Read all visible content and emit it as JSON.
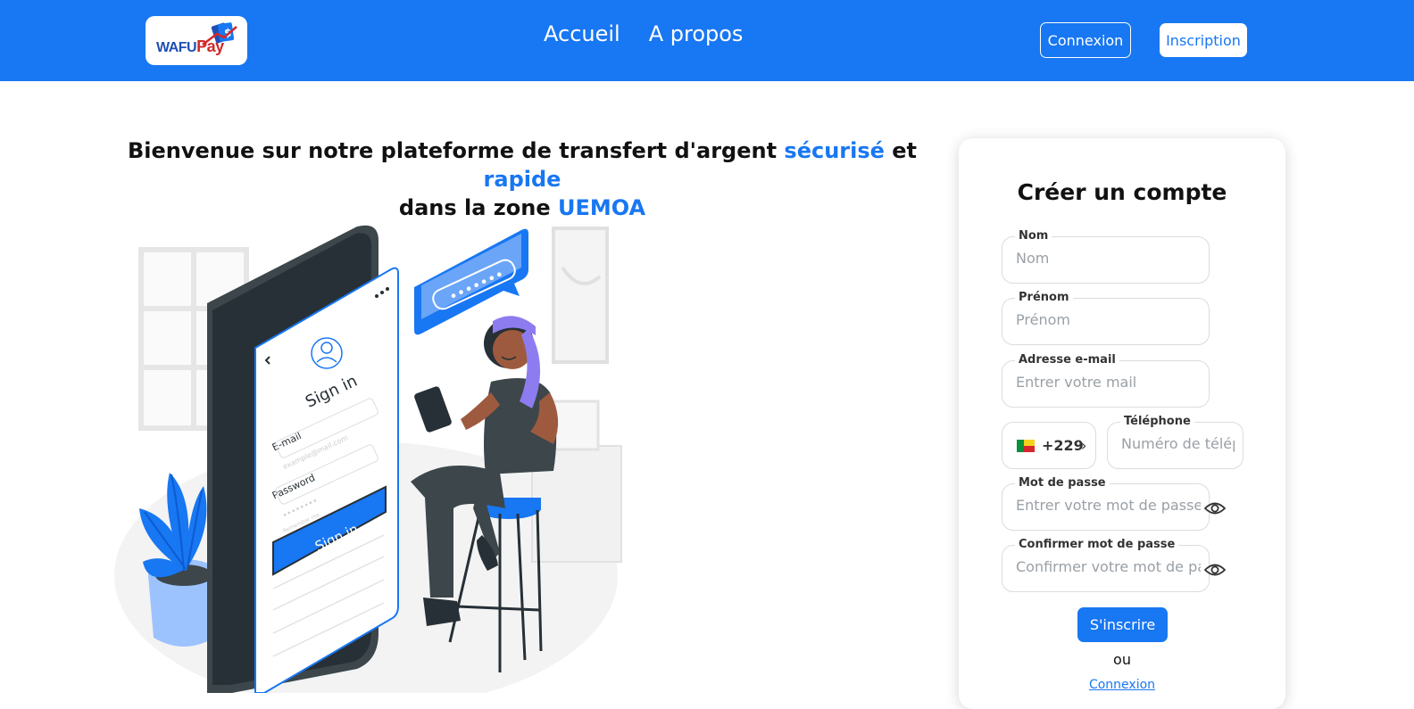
{
  "header": {
    "logo": {
      "text_main": "WAFU",
      "text_accent": "Pay",
      "badge": "$"
    },
    "nav": [
      {
        "label": "Accueil"
      },
      {
        "label": "A propos"
      }
    ],
    "login_label": "Connexion",
    "signup_label": "Inscription"
  },
  "hero": {
    "title_part1": "Bienvenue sur notre plateforme de transfert d'argent ",
    "title_hl1": "sécurisé",
    "title_part2": " et ",
    "title_hl2": "rapide",
    "title_part3": " dans la zone ",
    "title_hl3": "UEMOA",
    "illustration": {
      "screen_title": "Sign in",
      "email_label": "E-mail",
      "email_placeholder": "example@mail.com",
      "password_label": "Password",
      "password_mask": "••••••••",
      "remember_label": "Remember me",
      "button_label": "Sign in",
      "bubble_mask": "•••••••"
    }
  },
  "form": {
    "title": "Créer un compte",
    "fields": [
      {
        "label": "Nom",
        "placeholder": "Nom"
      },
      {
        "label": "Prénom",
        "placeholder": "Prénom"
      },
      {
        "label": "Adresse e-mail",
        "placeholder": "Entrer votre mail"
      },
      {
        "label": "Téléphone",
        "placeholder": "Numéro de téléphone"
      },
      {
        "label": "Mot de passe",
        "placeholder": "Entrer votre mot de passe"
      },
      {
        "label": "Confirmer mot de passe",
        "placeholder": "Confirmer votre mot de passe"
      }
    ],
    "country": {
      "code": "+229",
      "chevron": "›",
      "flag": "benin-flag"
    },
    "submit_label": "S'inscrire",
    "or_label": "ou",
    "login_link": "Connexion"
  },
  "colors": {
    "primary": "#1877f2",
    "accent_red": "#d22a2a",
    "text": "#111111"
  }
}
